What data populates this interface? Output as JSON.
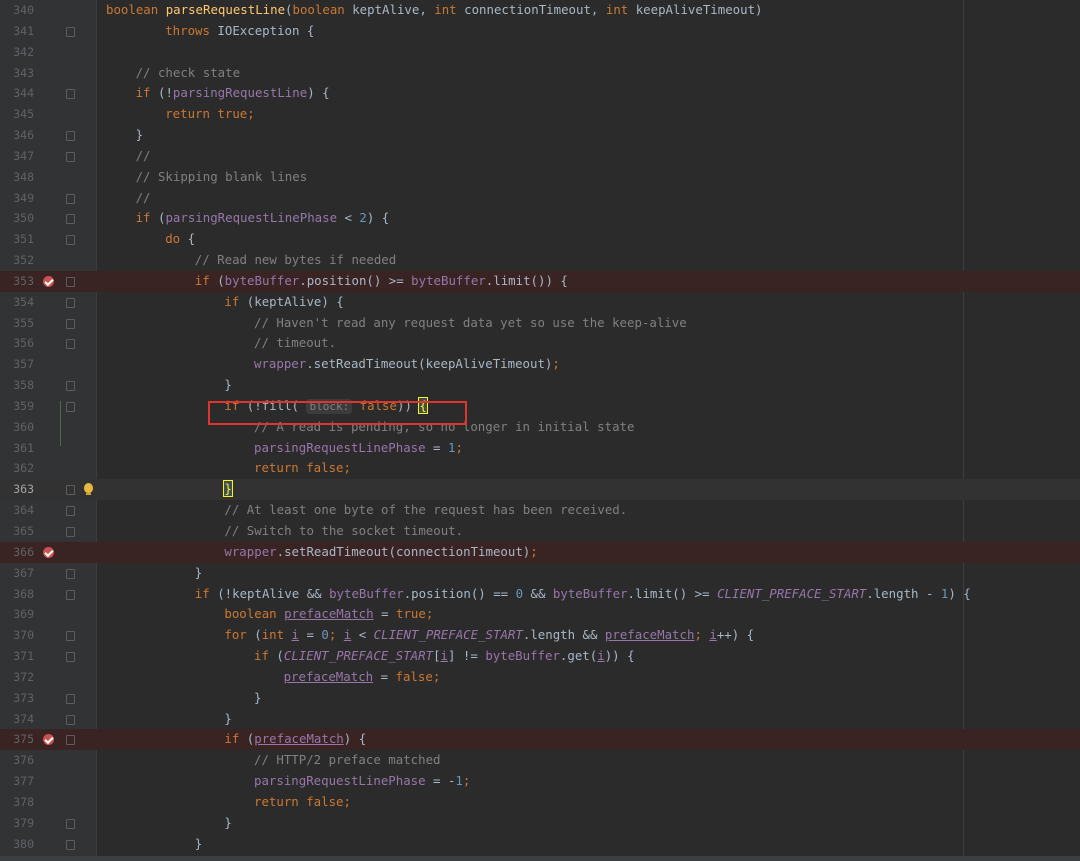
{
  "editor": {
    "lines": [
      {
        "ln": "340",
        "breakpoint": false,
        "caret": false,
        "bulb": false,
        "fold": false,
        "indent": 0,
        "tokens": [
          [
            "kw",
            "boolean "
          ],
          [
            "fn",
            "parseRequestLine"
          ],
          [
            "",
            "("
          ],
          [
            "kw",
            "boolean "
          ],
          [
            "",
            "keptAlive, "
          ],
          [
            "kw",
            "int "
          ],
          [
            "",
            "connectionTimeout, "
          ],
          [
            "kw",
            "int "
          ],
          [
            "",
            "keepAliveTimeout)"
          ]
        ]
      },
      {
        "ln": "341",
        "breakpoint": false,
        "caret": false,
        "bulb": false,
        "fold": true,
        "indent": 2,
        "tokens": [
          [
            "kw",
            "throws "
          ],
          [
            "",
            "IOException {"
          ]
        ]
      },
      {
        "ln": "342",
        "breakpoint": false,
        "caret": false,
        "bulb": false,
        "fold": false,
        "indent": 0,
        "tokens": []
      },
      {
        "ln": "343",
        "breakpoint": false,
        "caret": false,
        "bulb": false,
        "fold": false,
        "indent": 1,
        "tokens": [
          [
            "cm",
            "// check state"
          ]
        ]
      },
      {
        "ln": "344",
        "breakpoint": false,
        "caret": false,
        "bulb": false,
        "fold": true,
        "indent": 1,
        "tokens": [
          [
            "kw",
            "if "
          ],
          [
            "",
            "(!"
          ],
          [
            "fld",
            "parsingRequestLine"
          ],
          [
            "",
            ") {"
          ]
        ]
      },
      {
        "ln": "345",
        "breakpoint": false,
        "caret": false,
        "bulb": false,
        "fold": false,
        "indent": 2,
        "tokens": [
          [
            "kw",
            "return true;"
          ]
        ]
      },
      {
        "ln": "346",
        "breakpoint": false,
        "caret": false,
        "bulb": false,
        "fold": true,
        "indent": 1,
        "tokens": [
          [
            "",
            "}"
          ]
        ]
      },
      {
        "ln": "347",
        "breakpoint": false,
        "caret": false,
        "bulb": false,
        "fold": true,
        "indent": 1,
        "tokens": [
          [
            "cm",
            "//"
          ]
        ]
      },
      {
        "ln": "348",
        "breakpoint": false,
        "caret": false,
        "bulb": false,
        "fold": false,
        "indent": 1,
        "tokens": [
          [
            "cm",
            "// Skipping blank lines"
          ]
        ]
      },
      {
        "ln": "349",
        "breakpoint": false,
        "caret": false,
        "bulb": false,
        "fold": true,
        "indent": 1,
        "tokens": [
          [
            "cm",
            "//"
          ]
        ]
      },
      {
        "ln": "350",
        "breakpoint": false,
        "caret": false,
        "bulb": false,
        "fold": true,
        "indent": 1,
        "tokens": [
          [
            "kw",
            "if "
          ],
          [
            "",
            "("
          ],
          [
            "fld",
            "parsingRequestLinePhase"
          ],
          [
            "",
            " < "
          ],
          [
            "num",
            "2"
          ],
          [
            "",
            ") {"
          ]
        ]
      },
      {
        "ln": "351",
        "breakpoint": false,
        "caret": false,
        "bulb": false,
        "fold": true,
        "indent": 2,
        "tokens": [
          [
            "kw",
            "do "
          ],
          [
            "",
            "{"
          ]
        ]
      },
      {
        "ln": "352",
        "breakpoint": false,
        "caret": false,
        "bulb": false,
        "fold": false,
        "indent": 3,
        "tokens": [
          [
            "cm",
            "// Read new bytes if needed"
          ]
        ]
      },
      {
        "ln": "353",
        "breakpoint": true,
        "caret": false,
        "bulb": false,
        "fold": true,
        "indent": 3,
        "tokens": [
          [
            "kw",
            "if "
          ],
          [
            "",
            "("
          ],
          [
            "fld",
            "byteBuffer"
          ],
          [
            "",
            ".position() >= "
          ],
          [
            "fld",
            "byteBuffer"
          ],
          [
            "",
            ".limit()) {"
          ]
        ]
      },
      {
        "ln": "354",
        "breakpoint": false,
        "caret": false,
        "bulb": false,
        "fold": true,
        "indent": 4,
        "tokens": [
          [
            "kw",
            "if "
          ],
          [
            "",
            "(keptAlive) {"
          ]
        ]
      },
      {
        "ln": "355",
        "breakpoint": false,
        "caret": false,
        "bulb": false,
        "fold": true,
        "indent": 5,
        "tokens": [
          [
            "cm",
            "// Haven't read any request data yet so use the keep-alive"
          ]
        ]
      },
      {
        "ln": "356",
        "breakpoint": false,
        "caret": false,
        "bulb": false,
        "fold": true,
        "indent": 5,
        "tokens": [
          [
            "cm",
            "// timeout."
          ]
        ]
      },
      {
        "ln": "357",
        "breakpoint": false,
        "caret": false,
        "bulb": false,
        "fold": false,
        "indent": 5,
        "tokens": [
          [
            "fld",
            "wrapper"
          ],
          [
            "",
            ".setReadTimeout(keepAliveTimeout)"
          ],
          [
            "kw",
            ";"
          ]
        ]
      },
      {
        "ln": "358",
        "breakpoint": false,
        "caret": false,
        "bulb": false,
        "fold": true,
        "indent": 4,
        "tokens": [
          [
            "",
            "}"
          ]
        ]
      },
      {
        "ln": "359",
        "breakpoint": false,
        "caret": false,
        "bulb": false,
        "fold": true,
        "indent": 4,
        "tokens": [
          [
            "kw",
            "if "
          ],
          [
            "",
            "(!fill( "
          ],
          [
            "hint",
            "block:"
          ],
          [
            "kw",
            " false"
          ],
          [
            "",
            "))"
          ],
          [
            "kw",
            " "
          ],
          [
            "brace",
            "{"
          ]
        ]
      },
      {
        "ln": "360",
        "breakpoint": false,
        "caret": false,
        "bulb": false,
        "fold": false,
        "indent": 5,
        "tokens": [
          [
            "cm",
            "// A read is pending, so no longer in initial state"
          ]
        ]
      },
      {
        "ln": "361",
        "breakpoint": false,
        "caret": false,
        "bulb": false,
        "fold": false,
        "indent": 5,
        "tokens": [
          [
            "fld",
            "parsingRequestLinePhase"
          ],
          [
            "",
            " = "
          ],
          [
            "num",
            "1"
          ],
          [
            "kw",
            ";"
          ]
        ]
      },
      {
        "ln": "362",
        "breakpoint": false,
        "caret": false,
        "bulb": false,
        "fold": false,
        "indent": 5,
        "tokens": [
          [
            "kw",
            "return false;"
          ]
        ]
      },
      {
        "ln": "363",
        "breakpoint": false,
        "caret": true,
        "bulb": true,
        "fold": true,
        "indent": 4,
        "tokens": [
          [
            "brace",
            "}"
          ]
        ]
      },
      {
        "ln": "364",
        "breakpoint": false,
        "caret": false,
        "bulb": false,
        "fold": true,
        "indent": 4,
        "tokens": [
          [
            "cm",
            "// At least one byte of the request has been received."
          ]
        ]
      },
      {
        "ln": "365",
        "breakpoint": false,
        "caret": false,
        "bulb": false,
        "fold": true,
        "indent": 4,
        "tokens": [
          [
            "cm",
            "// Switch to the socket timeout."
          ]
        ]
      },
      {
        "ln": "366",
        "breakpoint": true,
        "caret": false,
        "bulb": false,
        "fold": false,
        "indent": 4,
        "tokens": [
          [
            "fld",
            "wrapper"
          ],
          [
            "",
            ".setReadTimeout(connectionTimeout)"
          ],
          [
            "kw",
            ";"
          ]
        ]
      },
      {
        "ln": "367",
        "breakpoint": false,
        "caret": false,
        "bulb": false,
        "fold": true,
        "indent": 3,
        "tokens": [
          [
            "",
            "}"
          ]
        ]
      },
      {
        "ln": "368",
        "breakpoint": false,
        "caret": false,
        "bulb": false,
        "fold": true,
        "indent": 3,
        "tokens": [
          [
            "kw",
            "if "
          ],
          [
            "",
            "(!keptAlive && "
          ],
          [
            "fld",
            "byteBuffer"
          ],
          [
            "",
            ".position() == "
          ],
          [
            "num",
            "0"
          ],
          [
            "",
            " && "
          ],
          [
            "fld",
            "byteBuffer"
          ],
          [
            "",
            ".limit() >= "
          ],
          [
            "cst",
            "CLIENT_PREFACE_START"
          ],
          [
            "",
            ".length - "
          ],
          [
            "num",
            "1"
          ],
          [
            "",
            ") {"
          ]
        ]
      },
      {
        "ln": "369",
        "breakpoint": false,
        "caret": false,
        "bulb": false,
        "fold": false,
        "indent": 4,
        "tokens": [
          [
            "kw",
            "boolean "
          ],
          [
            "ul",
            "prefaceMatch"
          ],
          [
            "",
            " = "
          ],
          [
            "kw",
            "true;"
          ]
        ]
      },
      {
        "ln": "370",
        "breakpoint": false,
        "caret": false,
        "bulb": false,
        "fold": true,
        "indent": 4,
        "tokens": [
          [
            "kw",
            "for "
          ],
          [
            "",
            "("
          ],
          [
            "kw",
            "int "
          ],
          [
            "ul",
            "i"
          ],
          [
            "",
            " = "
          ],
          [
            "num",
            "0"
          ],
          [
            "kw",
            "; "
          ],
          [
            "ul",
            "i"
          ],
          [
            "",
            " < "
          ],
          [
            "cst",
            "CLIENT_PREFACE_START"
          ],
          [
            "",
            ".length && "
          ],
          [
            "ul",
            "prefaceMatch"
          ],
          [
            "kw",
            "; "
          ],
          [
            "ul",
            "i"
          ],
          [
            "",
            "++) {"
          ]
        ]
      },
      {
        "ln": "371",
        "breakpoint": false,
        "caret": false,
        "bulb": false,
        "fold": true,
        "indent": 5,
        "tokens": [
          [
            "kw",
            "if "
          ],
          [
            "",
            "("
          ],
          [
            "cst",
            "CLIENT_PREFACE_START"
          ],
          [
            "",
            "["
          ],
          [
            "ul",
            "i"
          ],
          [
            "",
            "] != "
          ],
          [
            "fld",
            "byteBuffer"
          ],
          [
            "",
            ".get("
          ],
          [
            "ul",
            "i"
          ],
          [
            "",
            ")) {"
          ]
        ]
      },
      {
        "ln": "372",
        "breakpoint": false,
        "caret": false,
        "bulb": false,
        "fold": false,
        "indent": 6,
        "tokens": [
          [
            "ul",
            "prefaceMatch"
          ],
          [
            "",
            " = "
          ],
          [
            "kw",
            "false;"
          ]
        ]
      },
      {
        "ln": "373",
        "breakpoint": false,
        "caret": false,
        "bulb": false,
        "fold": true,
        "indent": 5,
        "tokens": [
          [
            "",
            "}"
          ]
        ]
      },
      {
        "ln": "374",
        "breakpoint": false,
        "caret": false,
        "bulb": false,
        "fold": true,
        "indent": 4,
        "tokens": [
          [
            "",
            "}"
          ]
        ]
      },
      {
        "ln": "375",
        "breakpoint": true,
        "caret": false,
        "bulb": false,
        "fold": true,
        "indent": 4,
        "tokens": [
          [
            "kw",
            "if "
          ],
          [
            "",
            "("
          ],
          [
            "ul",
            "prefaceMatch"
          ],
          [
            "",
            ") {"
          ]
        ]
      },
      {
        "ln": "376",
        "breakpoint": false,
        "caret": false,
        "bulb": false,
        "fold": false,
        "indent": 5,
        "tokens": [
          [
            "cm",
            "// HTTP/2 preface matched"
          ]
        ]
      },
      {
        "ln": "377",
        "breakpoint": false,
        "caret": false,
        "bulb": false,
        "fold": false,
        "indent": 5,
        "tokens": [
          [
            "fld",
            "parsingRequestLinePhase"
          ],
          [
            "",
            " = -"
          ],
          [
            "num",
            "1"
          ],
          [
            "kw",
            ";"
          ]
        ]
      },
      {
        "ln": "378",
        "breakpoint": false,
        "caret": false,
        "bulb": false,
        "fold": false,
        "indent": 5,
        "tokens": [
          [
            "kw",
            "return false;"
          ]
        ]
      },
      {
        "ln": "379",
        "breakpoint": false,
        "caret": false,
        "bulb": false,
        "fold": true,
        "indent": 4,
        "tokens": [
          [
            "",
            "}"
          ]
        ]
      },
      {
        "ln": "380",
        "breakpoint": false,
        "caret": false,
        "bulb": false,
        "fold": true,
        "indent": 3,
        "tokens": [
          [
            "",
            "}"
          ]
        ]
      }
    ]
  }
}
